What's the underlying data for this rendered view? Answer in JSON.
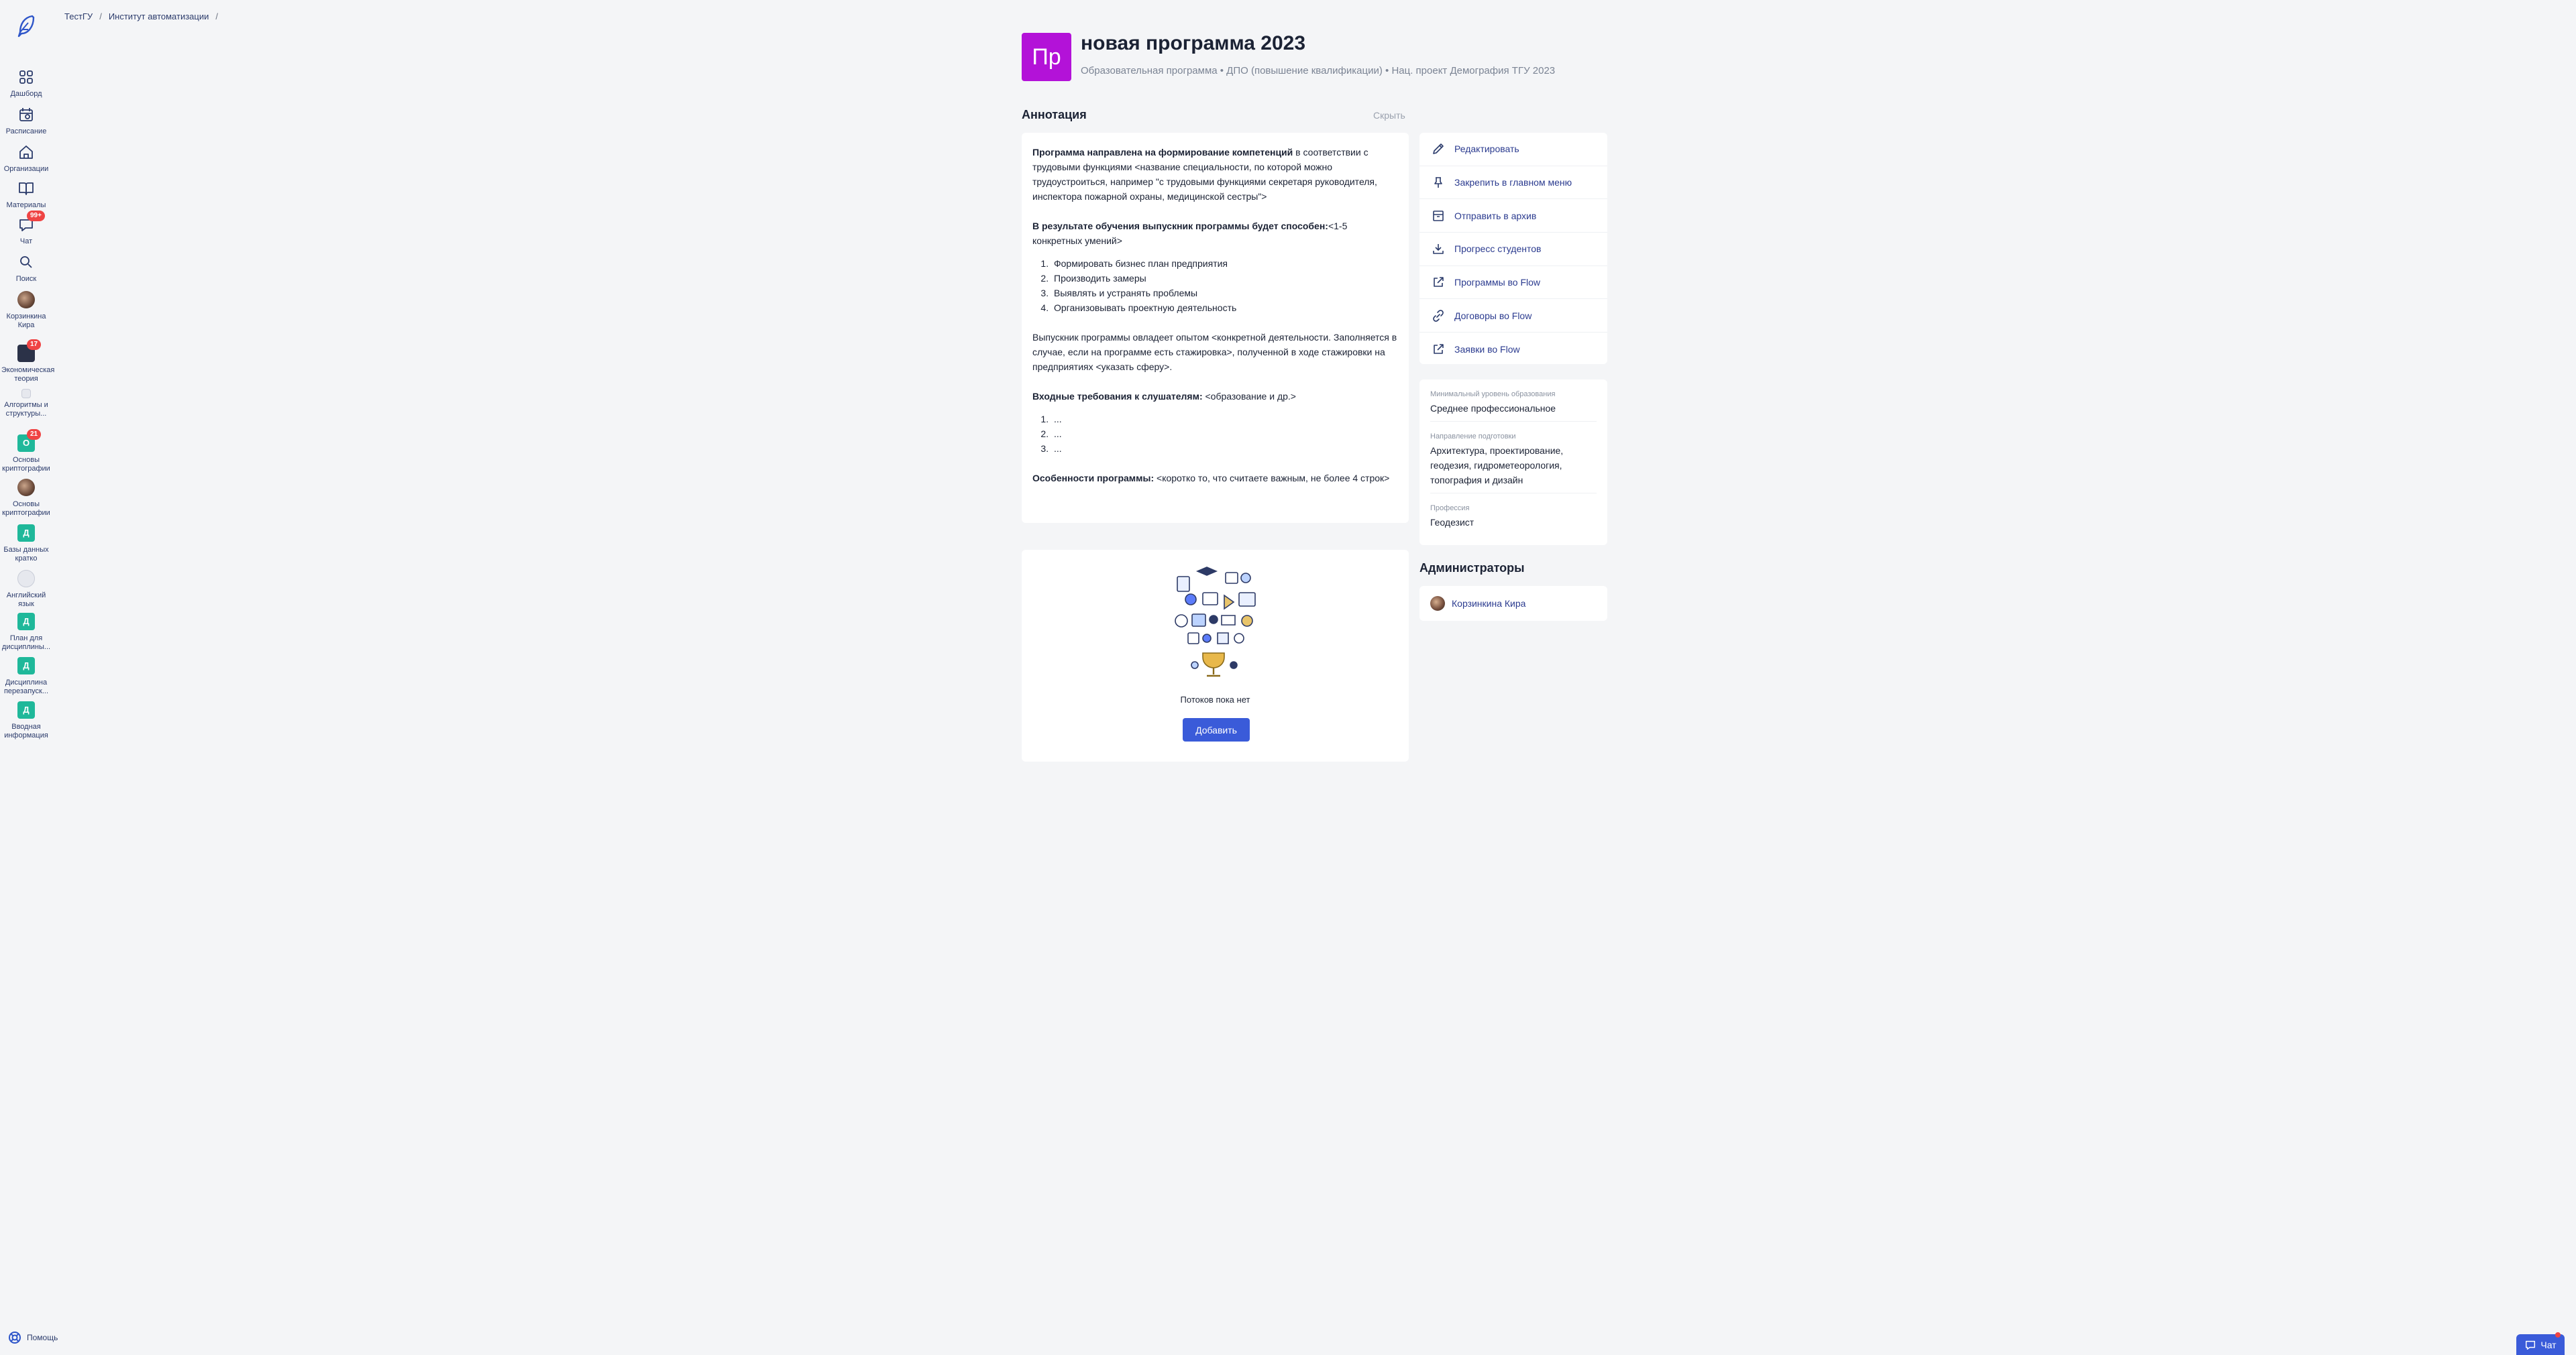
{
  "sidebar": {
    "logo_icon": "feather-logo-icon",
    "items": [
      {
        "label": "Дашборд",
        "icon": "dashboard-icon"
      },
      {
        "label": "Расписание",
        "icon": "calendar-icon"
      },
      {
        "label": "Организации",
        "icon": "home-icon"
      },
      {
        "label": "Материалы",
        "icon": "book-icon"
      },
      {
        "label": "Чат",
        "icon": "chat-icon",
        "badge": "99+"
      },
      {
        "label": "Поиск",
        "icon": "search-icon"
      },
      {
        "label": "Корзинкина Кира",
        "icon": "avatar"
      }
    ],
    "courses": [
      {
        "label": "Экономическая теория",
        "badge": "17"
      },
      {
        "label": "Алгоритмы и структуры..."
      },
      {
        "label": "Основы криптографии",
        "letter": "О",
        "badge": "21"
      },
      {
        "label": "Основы криптографии"
      },
      {
        "label": "Базы данных кратко",
        "letter": "Д"
      },
      {
        "label": "Английский язык"
      },
      {
        "label": "План для дисциплины...",
        "letter": "Д"
      },
      {
        "label": "Дисциплина перезапуск...",
        "letter": "Д"
      },
      {
        "label": "Вводная информация",
        "letter": "Д"
      }
    ],
    "help_label": "Помощь"
  },
  "breadcrumb": {
    "items": [
      "ТестГУ",
      "Институт автоматизации"
    ],
    "separator": "/"
  },
  "program": {
    "avatar_letters": "Пр",
    "avatar_color": "#b312d8",
    "title": "новая программа 2023",
    "meta": "Образовательная программа • ДПО (повышение квалификации) • Нац. проект Демография ТГУ 2023"
  },
  "annotation": {
    "heading": "Аннотация",
    "hide_label": "Скрыть",
    "p1_bold": "Программа направлена на формирование компетенций",
    "p1_rest": " в соответствии с трудовыми функциями <название специальности, по которой можно трудоустроиться, например \"с трудовыми функциями секретаря руководителя, инспектора пожарной охраны, медицинской сестры\">",
    "p2_bold": "В результате обучения выпускник программы будет способен:",
    "p2_rest": "<1-5 конкретных умений>",
    "list1": [
      "Формировать бизнес план предприятия",
      "Производить замеры",
      "Выявлять и устранять проблемы",
      "Организовывать проектную деятельность"
    ],
    "p3": "Выпускник программы овладеет опытом <конкретной деятельности. Заполняется в случае, если на программе есть стажировка>, полученной в ходе стажировки на предприятиях <указать сферу>.",
    "p4_bold": "Входные требования к слушателям:",
    "p4_rest": " <образование и др.>",
    "list2": [
      "...",
      "...",
      "..."
    ],
    "p5_bold": "Особенности программы:",
    "p5_rest": " <коротко то, что считаете важным, не более 4 строк>"
  },
  "streams": {
    "empty_text": "Потоков пока нет",
    "add_label": "Добавить"
  },
  "actions": [
    {
      "label": "Редактировать",
      "icon": "pencil-icon"
    },
    {
      "label": "Закрепить в главном меню",
      "icon": "pin-icon"
    },
    {
      "label": "Отправить в архив",
      "icon": "archive-icon"
    },
    {
      "label": "Прогресс студентов",
      "icon": "download-icon"
    },
    {
      "label": "Программы во Flow",
      "icon": "external-link-icon"
    },
    {
      "label": "Договоры во Flow",
      "icon": "link-icon"
    },
    {
      "label": "Заявки во Flow",
      "icon": "external-link-icon"
    }
  ],
  "info": {
    "education_label": "Минимальный уровень образования",
    "education_value": "Среднее профессиональное",
    "direction_label": "Направление подготовки",
    "direction_value": "Архитектура, проектирование, геодезия, гидрометеорология, топография и дизайн",
    "profession_label": "Профессия",
    "profession_value": "Геодезист"
  },
  "admins": {
    "heading": "Администраторы",
    "list": [
      "Корзинкина Кира"
    ]
  },
  "chat_button": {
    "label": "Чат"
  },
  "colors": {
    "accent": "#3a5bd9",
    "link": "#2b3b8f",
    "badge": "#ef4444",
    "program_avatar": "#b312d8"
  }
}
